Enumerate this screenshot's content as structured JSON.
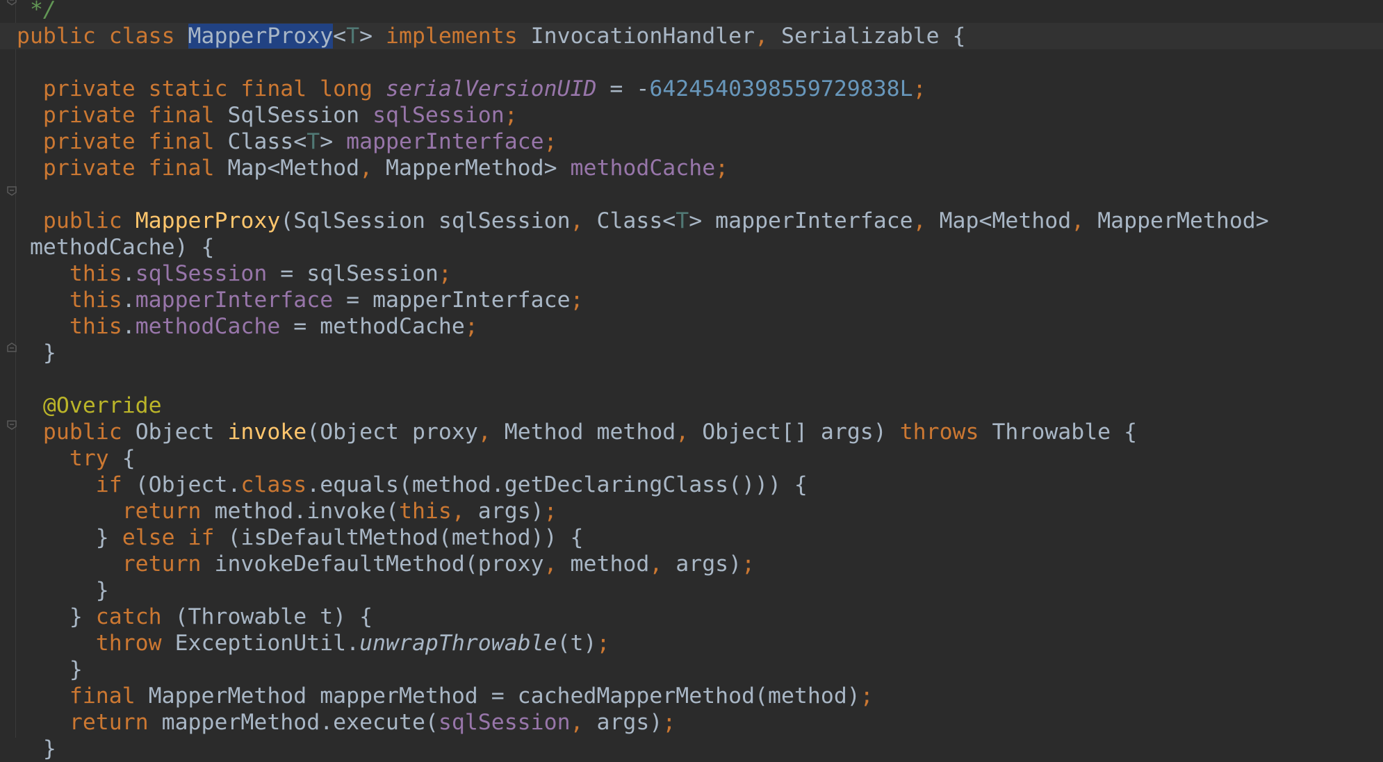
{
  "editor": {
    "highlighted_identifier": "MapperProxy",
    "lines": [
      [
        {
          "t": " */",
          "c": "cmt"
        }
      ],
      [
        {
          "t": "public class ",
          "c": "kw"
        },
        {
          "t": "MapperProxy",
          "c": "sel"
        },
        {
          "t": "<",
          "c": "ty"
        },
        {
          "t": "T",
          "c": "tp"
        },
        {
          "t": "> ",
          "c": "ty"
        },
        {
          "t": "implements ",
          "c": "kw"
        },
        {
          "t": "InvocationHandler",
          "c": "ty"
        },
        {
          "t": ", ",
          "c": "punc"
        },
        {
          "t": "Serializable {",
          "c": "ty"
        }
      ],
      [],
      [
        {
          "t": "  private static final long ",
          "c": "kw"
        },
        {
          "t": "serialVersionUID",
          "c": "fld-it"
        },
        {
          "t": " = -",
          "c": "ty"
        },
        {
          "t": "6424540398559729838L",
          "c": "num"
        },
        {
          "t": ";",
          "c": "punc"
        }
      ],
      [
        {
          "t": "  private final ",
          "c": "kw"
        },
        {
          "t": "SqlSession ",
          "c": "ty"
        },
        {
          "t": "sqlSession",
          "c": "fld"
        },
        {
          "t": ";",
          "c": "punc"
        }
      ],
      [
        {
          "t": "  private final ",
          "c": "kw"
        },
        {
          "t": "Class<",
          "c": "ty"
        },
        {
          "t": "T",
          "c": "tp"
        },
        {
          "t": "> ",
          "c": "ty"
        },
        {
          "t": "mapperInterface",
          "c": "fld"
        },
        {
          "t": ";",
          "c": "punc"
        }
      ],
      [
        {
          "t": "  private final ",
          "c": "kw"
        },
        {
          "t": "Map<Method",
          "c": "ty"
        },
        {
          "t": ", ",
          "c": "punc"
        },
        {
          "t": "MapperMethod> ",
          "c": "ty"
        },
        {
          "t": "methodCache",
          "c": "fld"
        },
        {
          "t": ";",
          "c": "punc"
        }
      ],
      [],
      [
        {
          "t": "  public ",
          "c": "kw"
        },
        {
          "t": "MapperProxy",
          "c": "fn"
        },
        {
          "t": "(SqlSession sqlSession",
          "c": "ty"
        },
        {
          "t": ", ",
          "c": "punc"
        },
        {
          "t": "Class<",
          "c": "ty"
        },
        {
          "t": "T",
          "c": "tp"
        },
        {
          "t": "> mapperInterface",
          "c": "ty"
        },
        {
          "t": ", ",
          "c": "punc"
        },
        {
          "t": "Map<Method",
          "c": "ty"
        },
        {
          "t": ", ",
          "c": "punc"
        },
        {
          "t": "MapperMethod>",
          "c": "ty"
        }
      ],
      [
        {
          "t": " methodCache) {",
          "c": "ty"
        }
      ],
      [
        {
          "t": "    this",
          "c": "kw"
        },
        {
          "t": ".",
          "c": "ty"
        },
        {
          "t": "sqlSession",
          "c": "fld"
        },
        {
          "t": " = sqlSession",
          "c": "ty"
        },
        {
          "t": ";",
          "c": "punc"
        }
      ],
      [
        {
          "t": "    this",
          "c": "kw"
        },
        {
          "t": ".",
          "c": "ty"
        },
        {
          "t": "mapperInterface",
          "c": "fld"
        },
        {
          "t": " = mapperInterface",
          "c": "ty"
        },
        {
          "t": ";",
          "c": "punc"
        }
      ],
      [
        {
          "t": "    this",
          "c": "kw"
        },
        {
          "t": ".",
          "c": "ty"
        },
        {
          "t": "methodCache",
          "c": "fld"
        },
        {
          "t": " = methodCache",
          "c": "ty"
        },
        {
          "t": ";",
          "c": "punc"
        }
      ],
      [
        {
          "t": "  }",
          "c": "ty"
        }
      ],
      [],
      [
        {
          "t": "  @Override",
          "c": "ann"
        }
      ],
      [
        {
          "t": "  public ",
          "c": "kw"
        },
        {
          "t": "Object ",
          "c": "ty"
        },
        {
          "t": "invoke",
          "c": "fn"
        },
        {
          "t": "(Object proxy",
          "c": "ty"
        },
        {
          "t": ", ",
          "c": "punc"
        },
        {
          "t": "Method method",
          "c": "ty"
        },
        {
          "t": ", ",
          "c": "punc"
        },
        {
          "t": "Object[] args) ",
          "c": "ty"
        },
        {
          "t": "throws ",
          "c": "kw"
        },
        {
          "t": "Throwable {",
          "c": "ty"
        }
      ],
      [
        {
          "t": "    try ",
          "c": "kw"
        },
        {
          "t": "{",
          "c": "ty"
        }
      ],
      [
        {
          "t": "      if ",
          "c": "kw"
        },
        {
          "t": "(Object.",
          "c": "ty"
        },
        {
          "t": "class",
          "c": "kw"
        },
        {
          "t": ".equals(method.getDeclaringClass())) {",
          "c": "ty"
        }
      ],
      [
        {
          "t": "        return ",
          "c": "kw"
        },
        {
          "t": "method.invoke(",
          "c": "ty"
        },
        {
          "t": "this",
          "c": "kw"
        },
        {
          "t": ", ",
          "c": "punc"
        },
        {
          "t": "args)",
          "c": "ty"
        },
        {
          "t": ";",
          "c": "punc"
        }
      ],
      [
        {
          "t": "      } ",
          "c": "ty"
        },
        {
          "t": "else if ",
          "c": "kw"
        },
        {
          "t": "(isDefaultMethod(method)) {",
          "c": "ty"
        }
      ],
      [
        {
          "t": "        return ",
          "c": "kw"
        },
        {
          "t": "invokeDefaultMethod(proxy",
          "c": "ty"
        },
        {
          "t": ", ",
          "c": "punc"
        },
        {
          "t": "method",
          "c": "ty"
        },
        {
          "t": ", ",
          "c": "punc"
        },
        {
          "t": "args)",
          "c": "ty"
        },
        {
          "t": ";",
          "c": "punc"
        }
      ],
      [
        {
          "t": "      }",
          "c": "ty"
        }
      ],
      [
        {
          "t": "    } ",
          "c": "ty"
        },
        {
          "t": "catch ",
          "c": "kw"
        },
        {
          "t": "(Throwable t) {",
          "c": "ty"
        }
      ],
      [
        {
          "t": "      throw ",
          "c": "kw"
        },
        {
          "t": "ExceptionUtil.",
          "c": "ty"
        },
        {
          "t": "unwrapThrowable",
          "c": "it"
        },
        {
          "t": "(t)",
          "c": "ty"
        },
        {
          "t": ";",
          "c": "punc"
        }
      ],
      [
        {
          "t": "    }",
          "c": "ty"
        }
      ],
      [
        {
          "t": "    final ",
          "c": "kw"
        },
        {
          "t": "MapperMethod mapperMethod = cachedMapperMethod(method)",
          "c": "ty"
        },
        {
          "t": ";",
          "c": "punc"
        }
      ],
      [
        {
          "t": "    return ",
          "c": "kw"
        },
        {
          "t": "mapperMethod.execute(",
          "c": "ty"
        },
        {
          "t": "sqlSession",
          "c": "fld"
        },
        {
          "t": ", ",
          "c": "punc"
        },
        {
          "t": "args)",
          "c": "ty"
        },
        {
          "t": ";",
          "c": "punc"
        }
      ],
      [
        {
          "t": "  }",
          "c": "ty"
        }
      ]
    ]
  },
  "gutter": {
    "fold_markers": [
      "fold-collapse-icon",
      "fold-end-icon",
      "fold-end-icon",
      "fold-collapse-icon"
    ]
  },
  "colors": {
    "background": "#2b2b2b",
    "keyword": "#cc7832",
    "text": "#a9b7c6",
    "field": "#9876aa",
    "number": "#6897bb",
    "function": "#ffc66d",
    "annotation": "#bbb529",
    "comment": "#629755",
    "selection": "#214283"
  }
}
